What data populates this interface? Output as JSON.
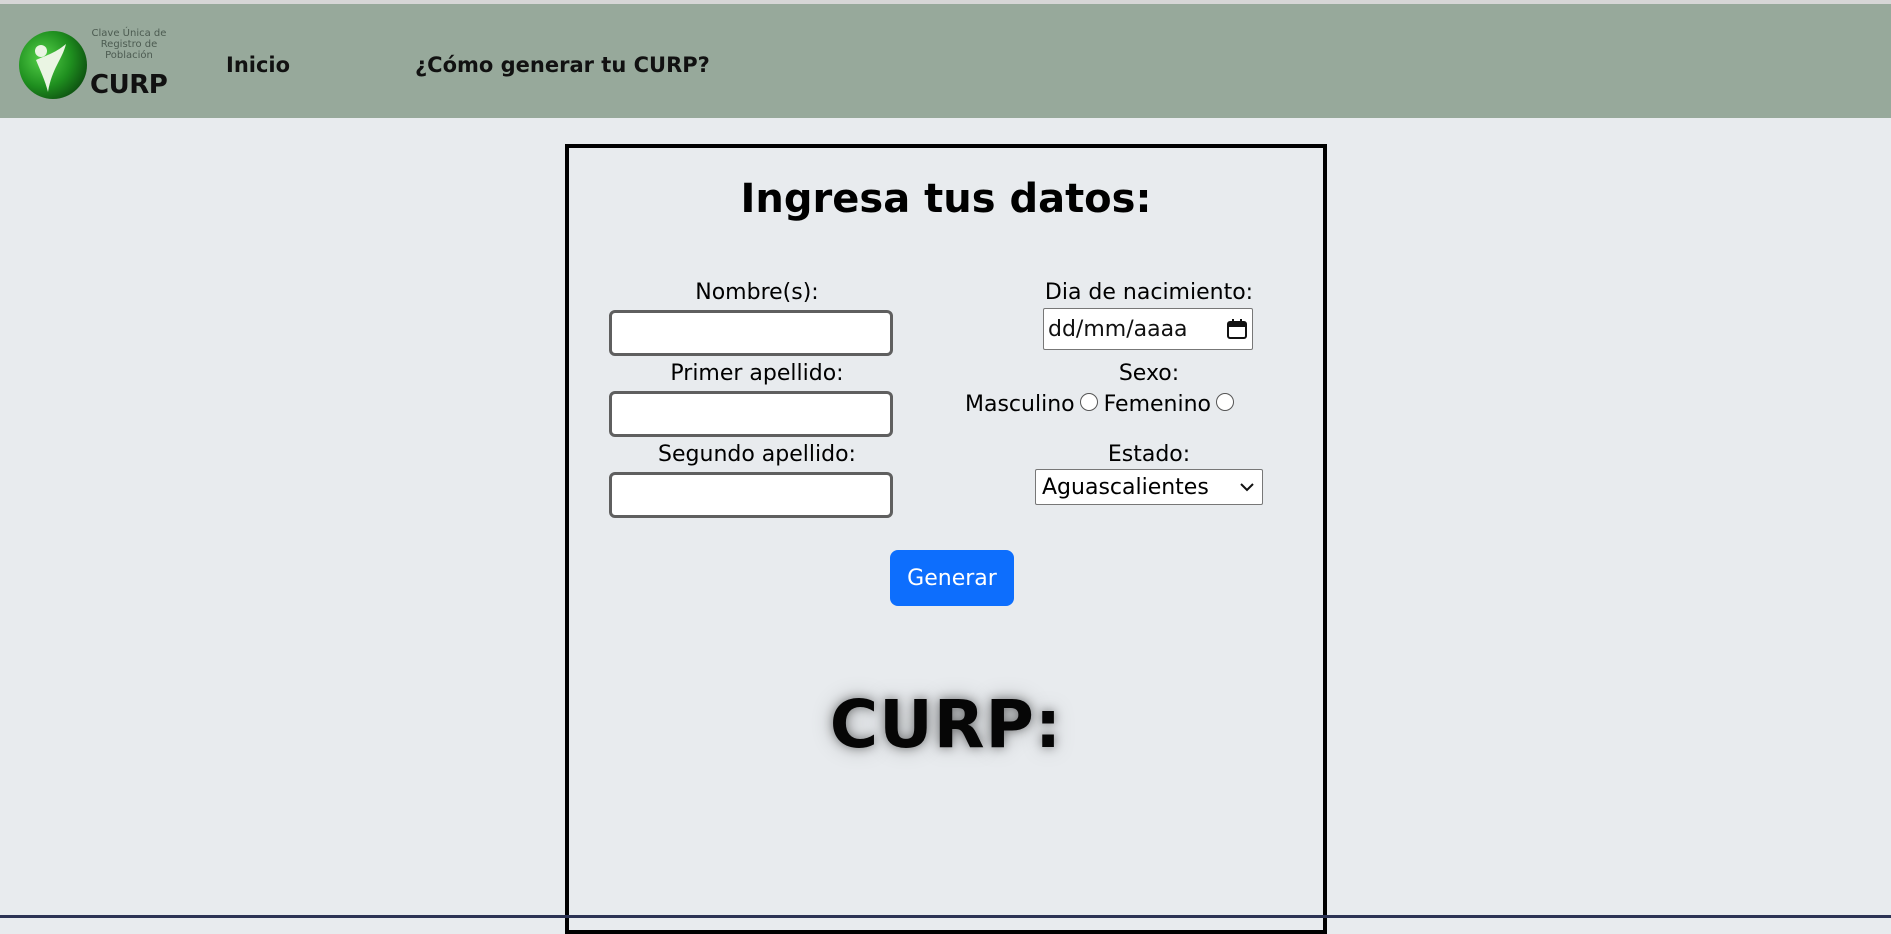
{
  "navbar": {
    "logo_small_text": "Clave Única de Registro de Población",
    "logo_main_text": "CURP",
    "links": [
      {
        "label": "Inicio"
      },
      {
        "label": "¿Cómo generar tu CURP?"
      }
    ]
  },
  "form": {
    "title": "Ingresa tus datos:",
    "fields": {
      "nombre_label": "Nombre(s):",
      "primer_apellido_label": "Primer apellido:",
      "segundo_apellido_label": "Segundo apellido:",
      "nacimiento_label": "Dia de nacimiento:",
      "nacimiento_placeholder": "dd/mm/aaaa",
      "sexo_label": "Sexo:",
      "sexo_options": [
        "Masculino",
        "Femenino"
      ],
      "estado_label": "Estado:",
      "estado_selected": "Aguascalientes"
    },
    "submit_label": "Generar",
    "result_label": "CURP:"
  },
  "colors": {
    "navbar_bg": "#97a99b",
    "page_bg": "#e8ebee",
    "button_bg": "#0d6efd",
    "logo_green": "#2e9b2e"
  },
  "icons": {
    "calendar": "calendar-icon",
    "select_arrow": "chevron-down-icon",
    "logo_figure": "person-leaf-icon"
  }
}
